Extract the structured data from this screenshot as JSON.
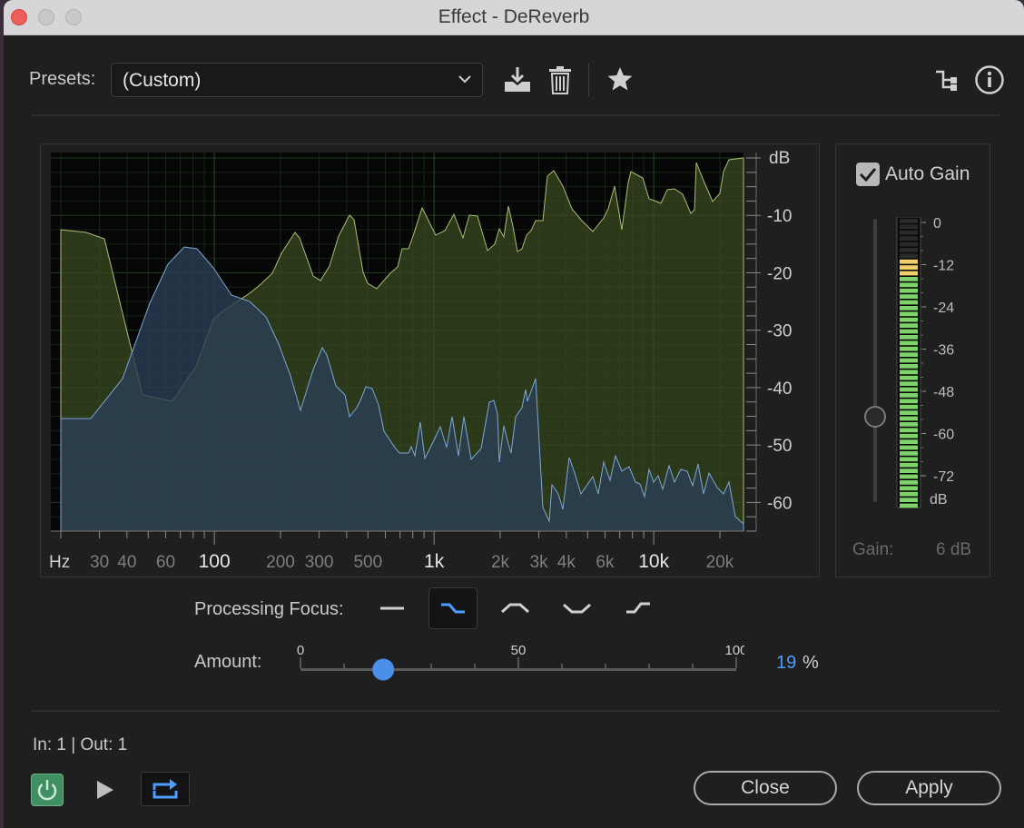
{
  "window": {
    "title": "Effect - DeReverb"
  },
  "presets": {
    "label": "Presets:",
    "value": "(Custom)"
  },
  "toolbar": {
    "save_icon": "save-preset-icon",
    "delete_icon": "trash-icon",
    "favorite_icon": "star-icon",
    "routing_icon": "channel-routing-icon",
    "info_icon": "info-icon"
  },
  "graph": {
    "db_unit": "dB",
    "db_ticks": [
      "-10",
      "-20",
      "-30",
      "-40",
      "-50",
      "-60"
    ],
    "hz_unit": "Hz",
    "freq_labels": [
      {
        "text": "30",
        "hz": 30,
        "bold": false
      },
      {
        "text": "40",
        "hz": 40,
        "bold": false
      },
      {
        "text": "60",
        "hz": 60,
        "bold": false
      },
      {
        "text": "100",
        "hz": 100,
        "bold": true
      },
      {
        "text": "200",
        "hz": 200,
        "bold": false
      },
      {
        "text": "300",
        "hz": 300,
        "bold": false
      },
      {
        "text": "500",
        "hz": 500,
        "bold": false
      },
      {
        "text": "1k",
        "hz": 1000,
        "bold": true
      },
      {
        "text": "2k",
        "hz": 2000,
        "bold": false
      },
      {
        "text": "3k",
        "hz": 3000,
        "bold": false
      },
      {
        "text": "4k",
        "hz": 4000,
        "bold": false
      },
      {
        "text": "6k",
        "hz": 6000,
        "bold": false
      },
      {
        "text": "10k",
        "hz": 10000,
        "bold": true
      },
      {
        "text": "20k",
        "hz": 20000,
        "bold": false
      }
    ],
    "colors": {
      "reverb_fill": "#3a4a22",
      "reverb_line": "#aebc72",
      "input_fill": "#2b3f55",
      "input_line": "#7ea9d6"
    }
  },
  "gain": {
    "auto_gain_label": "Auto Gain",
    "auto_gain_checked": true,
    "meter_ticks": [
      "0",
      "-12",
      "-24",
      "-36",
      "-48",
      "-60",
      "-72"
    ],
    "meter_unit": "dB",
    "gain_label": "Gain:",
    "gain_value": "6 dB"
  },
  "processing": {
    "label": "Processing Focus:",
    "selected_index": 1,
    "options": [
      "flat-focus-icon",
      "high-shelf-focus-icon",
      "mid-focus-icon",
      "notch-focus-icon",
      "low-shelf-focus-icon"
    ]
  },
  "amount": {
    "label": "Amount:",
    "min_label": "0",
    "mid_label": "50",
    "max_label": "100",
    "value": "19",
    "value_fraction": 0.19,
    "unit": "%"
  },
  "io": {
    "text": "In: 1 | Out: 1"
  },
  "footer": {
    "power_icon": "power-icon",
    "play_icon": "play-icon",
    "loop_icon": "loop-icon",
    "close_label": "Close",
    "apply_label": "Apply"
  }
}
